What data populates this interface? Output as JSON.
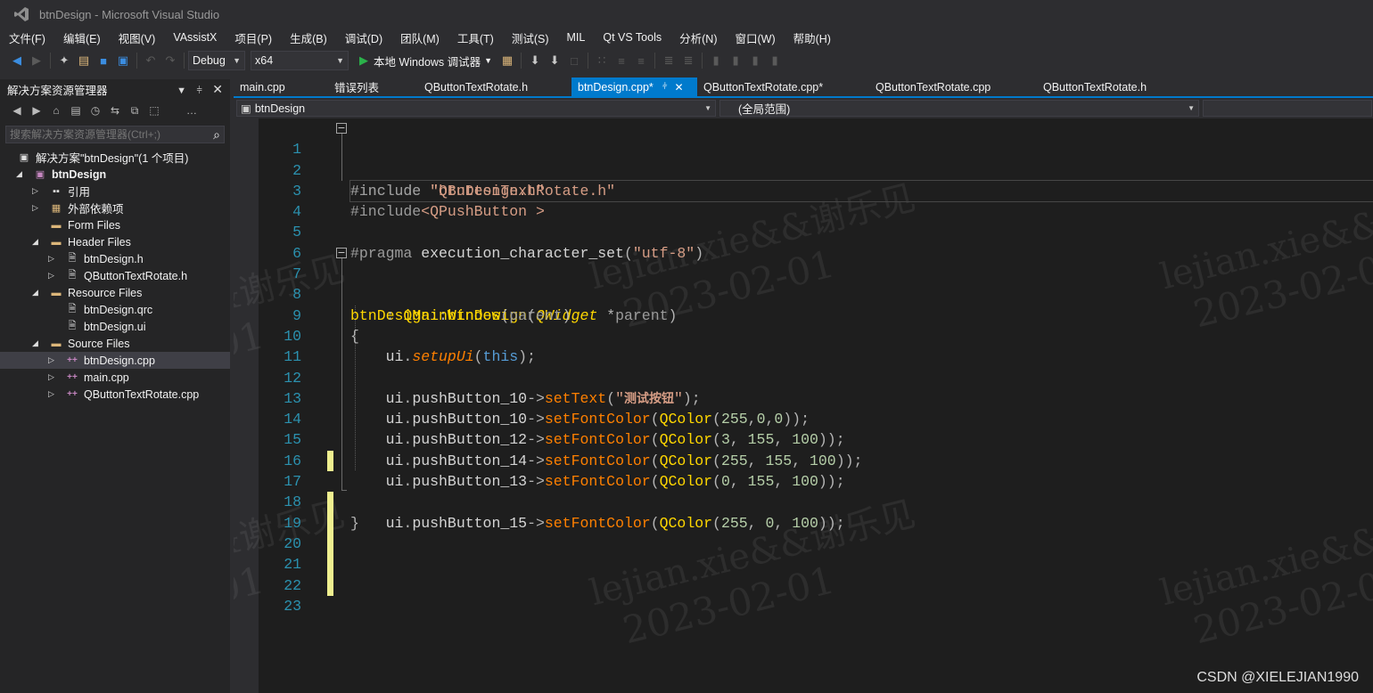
{
  "window": {
    "title": "btnDesign - Microsoft Visual Studio"
  },
  "menu": [
    "文件(F)",
    "编辑(E)",
    "视图(V)",
    "VAssistX",
    "项目(P)",
    "生成(B)",
    "调试(D)",
    "团队(M)",
    "工具(T)",
    "测试(S)",
    "MIL",
    "Qt VS Tools",
    "分析(N)",
    "窗口(W)",
    "帮助(H)"
  ],
  "toolbar": {
    "config": "Debug",
    "platform": "x64",
    "run_label": "本地 Windows 调试器"
  },
  "solution_explorer": {
    "title": "解决方案资源管理器",
    "search_placeholder": "搜索解决方案资源管理器(Ctrl+;)",
    "items": [
      {
        "label": "解决方案\"btnDesign\"(1 个项目)",
        "icon": "solution-icon"
      },
      {
        "label": "btnDesign",
        "icon": "project-icon"
      },
      {
        "label": "引用",
        "icon": "references-icon"
      },
      {
        "label": "外部依赖项",
        "icon": "external-deps-icon"
      },
      {
        "label": "Form Files",
        "icon": "folder-icon"
      },
      {
        "label": "Header Files",
        "icon": "folder-icon"
      },
      {
        "label": "btnDesign.h",
        "icon": "header-file-icon"
      },
      {
        "label": "QButtonTextRotate.h",
        "icon": "header-file-icon"
      },
      {
        "label": "Resource Files",
        "icon": "folder-icon"
      },
      {
        "label": "btnDesign.qrc",
        "icon": "file-icon"
      },
      {
        "label": "btnDesign.ui",
        "icon": "ui-file-icon"
      },
      {
        "label": "Source Files",
        "icon": "folder-icon"
      },
      {
        "label": "btnDesign.cpp",
        "icon": "cpp-file-icon"
      },
      {
        "label": "main.cpp",
        "icon": "cpp-file-icon"
      },
      {
        "label": "QButtonTextRotate.cpp",
        "icon": "cpp-file-icon"
      }
    ]
  },
  "tabs": [
    {
      "label": "main.cpp"
    },
    {
      "label": "错误列表"
    },
    {
      "label": "QButtonTextRotate.h"
    },
    {
      "label": "btnDesign.cpp*"
    },
    {
      "label": "QButtonTextRotate.cpp*"
    },
    {
      "label": "QButtonTextRotate.cpp"
    },
    {
      "label": "QButtonTextRotate.h"
    }
  ],
  "navbar": {
    "project": "btnDesign",
    "scope": "(全局范围)"
  },
  "editor": {
    "line_numbers": [
      "1",
      "2",
      "3",
      "4",
      "5",
      "6",
      "7",
      "8",
      "9",
      "10",
      "11",
      "12",
      "13",
      "14",
      "15",
      "16",
      "17",
      "18",
      "19",
      "20",
      "21",
      "22",
      "23"
    ]
  },
  "watermark": {
    "line1": "lejian.xie&&谢乐见",
    "line2": "2023-02-01"
  },
  "footer_credit": "CSDN @XIELEJIAN1990"
}
